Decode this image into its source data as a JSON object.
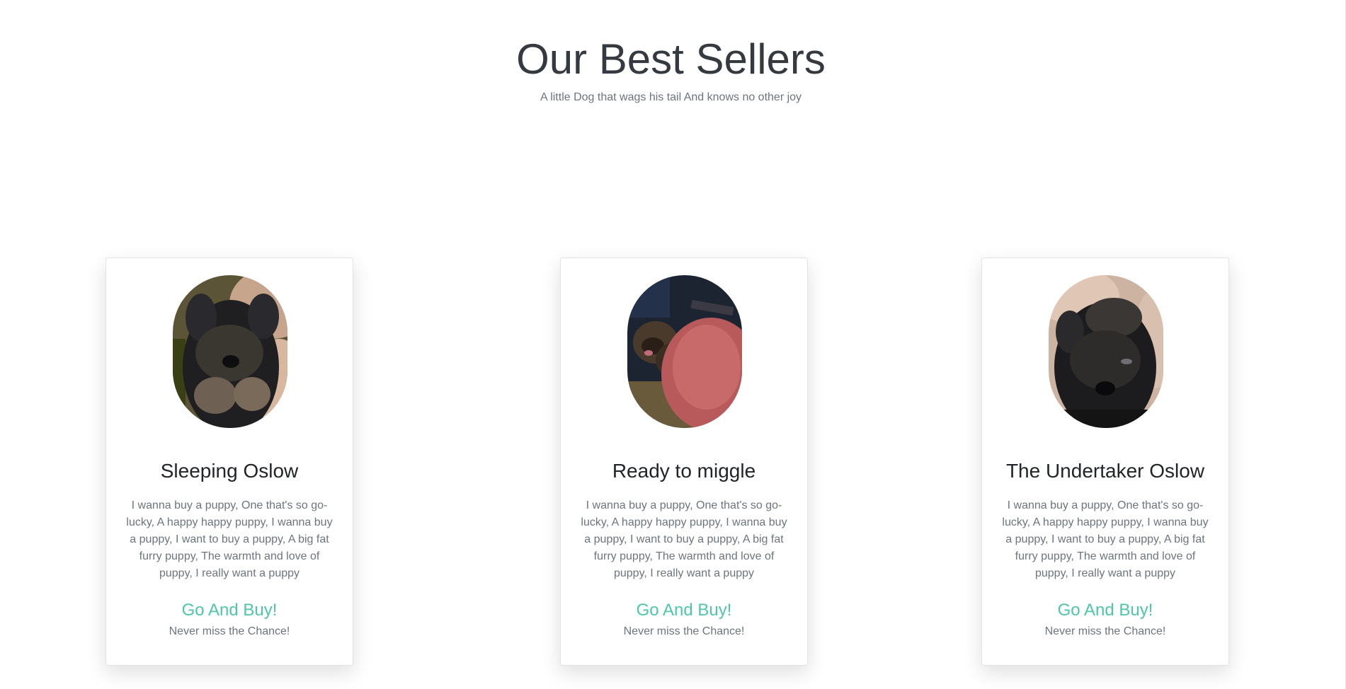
{
  "header": {
    "title": "Our Best Sellers",
    "subtitle": "A little Dog that wags his tail And knows no other joy"
  },
  "products": [
    {
      "name": "Sleeping Oslow",
      "description": "I wanna buy a puppy, One that's so go-lucky, A happy happy puppy, I wanna buy a puppy, I want to buy a puppy, A big fat furry puppy, The warmth and love of puppy, I really want a puppy",
      "cta": "Go And Buy!",
      "caption": "Never miss the Chance!"
    },
    {
      "name": "Ready to miggle",
      "description": "I wanna buy a puppy, One that's so go-lucky, A happy happy puppy, I wanna buy a puppy, I want to buy a puppy, A big fat furry puppy, The warmth and love of puppy, I really want a puppy",
      "cta": "Go And Buy!",
      "caption": "Never miss the Chance!"
    },
    {
      "name": "The Undertaker Oslow",
      "description": "I wanna buy a puppy, One that's so go-lucky, A happy happy puppy, I wanna buy a puppy, I want to buy a puppy, A big fat furry puppy, The warmth and love of puppy, I really want a puppy",
      "cta": "Go And Buy!",
      "caption": "Never miss the Chance!"
    }
  ],
  "colors": {
    "accent": "#4ec7a8",
    "heading": "#343a40",
    "muted": "#6c757d"
  }
}
